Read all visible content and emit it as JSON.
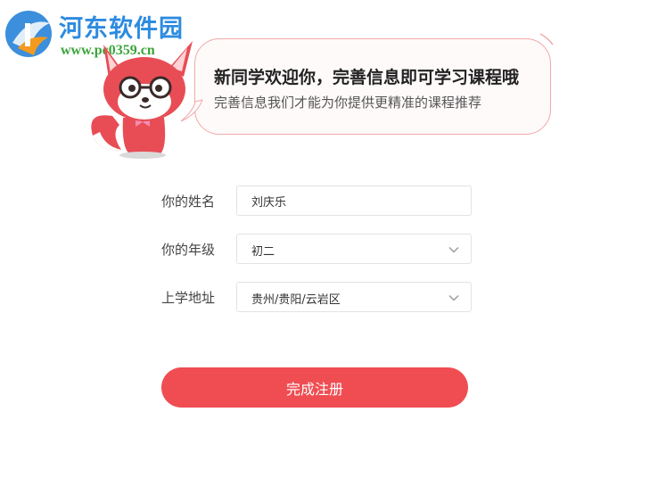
{
  "watermark": {
    "title": "河东软件园",
    "url": "www.pc0359.cn"
  },
  "welcome": {
    "title": "新同学欢迎你，完善信息即可学习课程哦",
    "subtitle": "完善信息我们才能为你提供更精准的课程推荐"
  },
  "form": {
    "name_label": "你的姓名",
    "name_value": "刘庆乐",
    "grade_label": "你的年级",
    "grade_value": "初二",
    "address_label": "上学地址",
    "address_value": "贵州/贵阳/云岩区"
  },
  "submit_label": "完成注册",
  "colors": {
    "accent": "#ef4d52",
    "bubble_border": "#f0a8a8",
    "watermark_blue": "#2d8be0",
    "watermark_green": "#3aa53a"
  }
}
